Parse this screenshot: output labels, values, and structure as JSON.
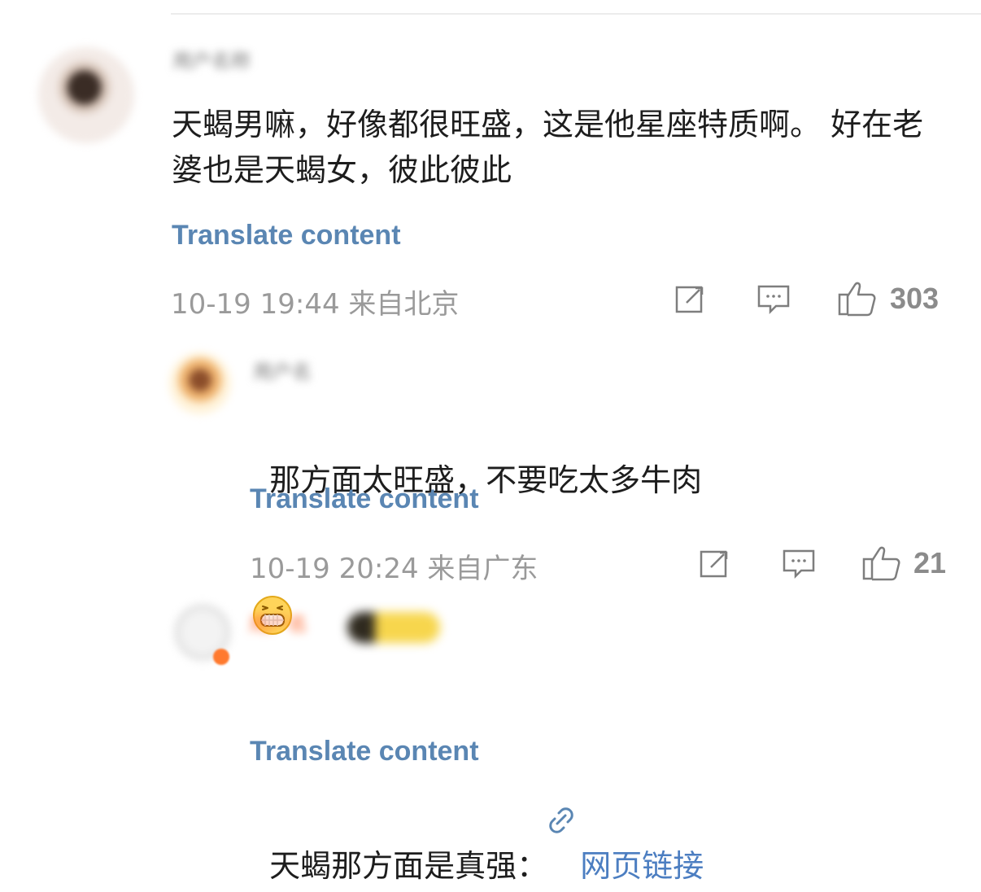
{
  "comments": [
    {
      "text": "天蝎男嘛，好像都很旺盛，这是他星座特质啊。 好在老婆也是天蝎女，彼此彼此",
      "translate_label": "Translate content",
      "meta": "10-19 19:44  来自北京",
      "like_count": "303"
    },
    {
      "text": "那方面太旺盛，不要吃太多牛肉",
      "emoji_icon": "grinning-face-icon",
      "translate_label": "Translate content",
      "meta": "10-19 20:24  来自广东",
      "like_count": "21"
    },
    {
      "text_prefix": "天蝎那方面是真强：",
      "link_text": "网页链接",
      "link_icon": "link-icon",
      "translate_label": "Translate content"
    }
  ],
  "icons": {
    "edit": "edit-icon",
    "reply": "reply-icon",
    "like": "thumbs-up-icon"
  },
  "colors": {
    "link": "#5a86b3",
    "meta_text": "#9a9a9a",
    "primary_text": "#1d1d1d",
    "divider": "#ececec"
  }
}
